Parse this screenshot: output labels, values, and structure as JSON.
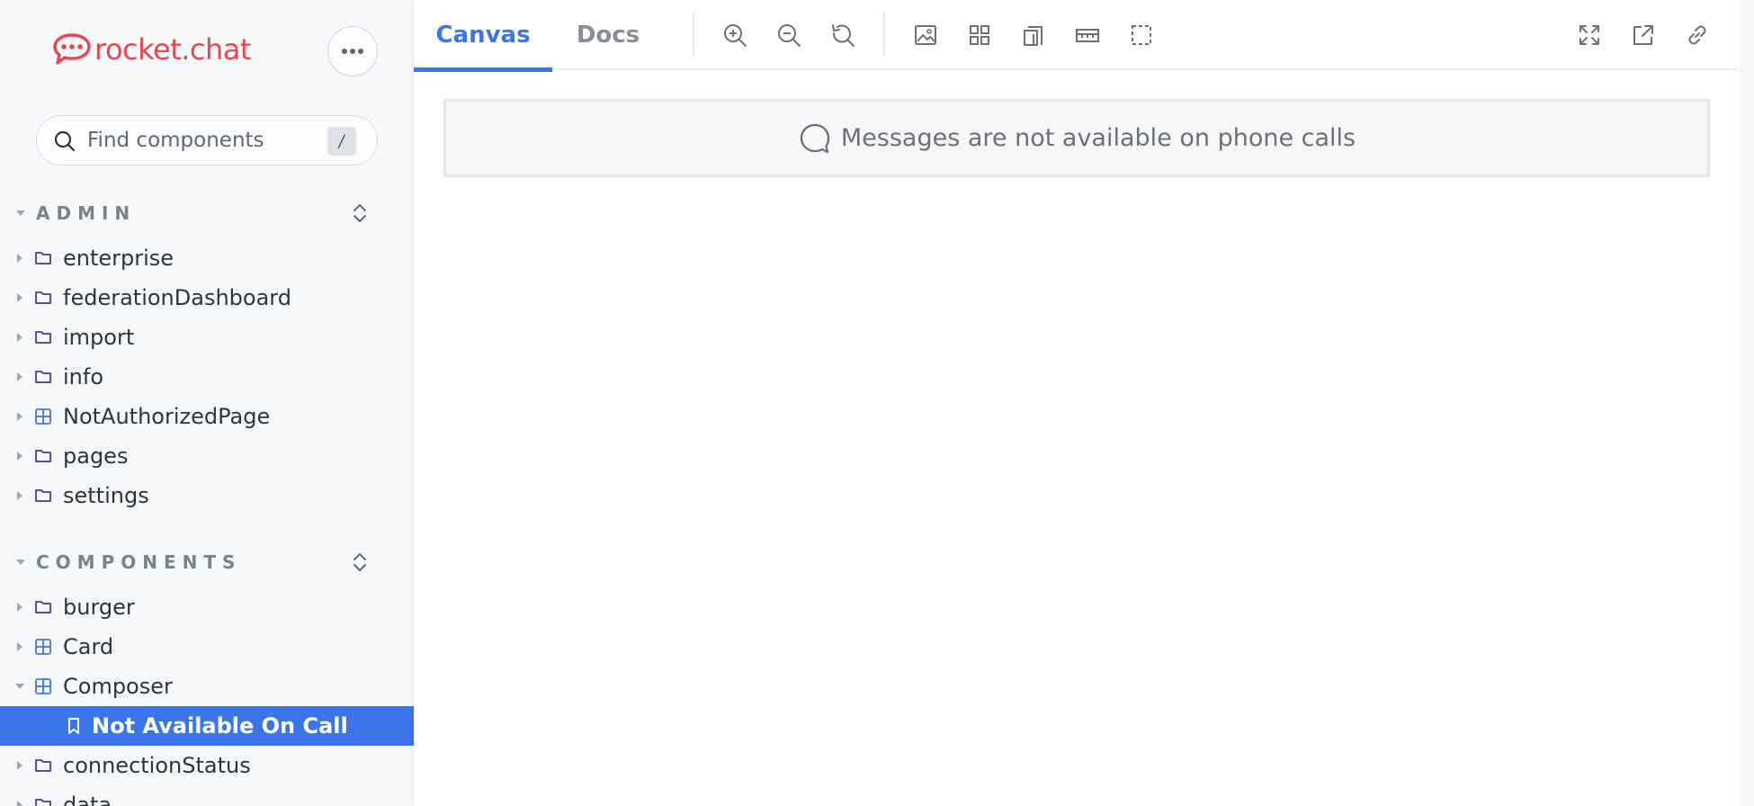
{
  "brand": {
    "name": "rocket.chat",
    "color": "#e9464f"
  },
  "search": {
    "placeholder": "Find components",
    "shortcut": "/"
  },
  "sections": [
    {
      "title": "ADMIN",
      "items": [
        {
          "label": "enterprise",
          "icon": "folder-icon"
        },
        {
          "label": "federationDashboard",
          "icon": "folder-icon"
        },
        {
          "label": "import",
          "icon": "folder-icon"
        },
        {
          "label": "info",
          "icon": "folder-icon"
        },
        {
          "label": "NotAuthorizedPage",
          "icon": "component-icon"
        },
        {
          "label": "pages",
          "icon": "folder-icon"
        },
        {
          "label": "settings",
          "icon": "folder-icon"
        }
      ]
    },
    {
      "title": "COMPONENTS",
      "items": [
        {
          "label": "burger",
          "icon": "folder-icon"
        },
        {
          "label": "Card",
          "icon": "component-icon"
        },
        {
          "label": "Composer",
          "icon": "component-icon",
          "expanded": true
        },
        {
          "label": "Not Available On Call",
          "icon": "story-icon",
          "selected": true
        },
        {
          "label": "connectionStatus",
          "icon": "folder-icon"
        },
        {
          "label": "data",
          "icon": "folder-icon"
        }
      ]
    }
  ],
  "tabs": [
    {
      "label": "Canvas",
      "active": true
    },
    {
      "label": "Docs",
      "active": false
    }
  ],
  "toolbar_icons": [
    "zoom-in-icon",
    "zoom-out-icon",
    "reset-zoom-icon",
    "background-icon",
    "grid-icon",
    "viewport-icon",
    "measure-icon",
    "outline-icon",
    "fullscreen-icon",
    "open-new-tab-icon",
    "copy-link-icon"
  ],
  "banner": {
    "text": "Messages are not available on phone calls",
    "icon": "chat-bubble-icon"
  },
  "colors": {
    "accent": "#3a76ea",
    "sidebar_bg": "#f6f9fc"
  }
}
